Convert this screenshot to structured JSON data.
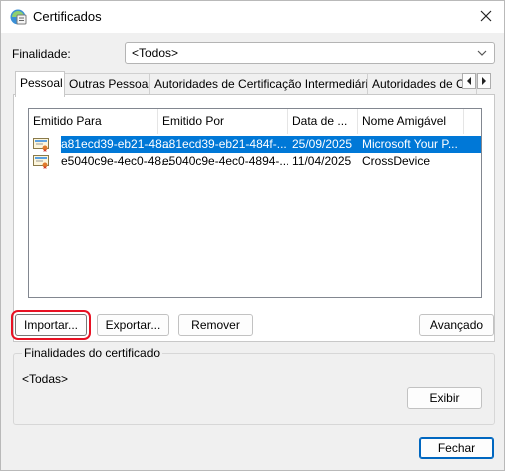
{
  "window": {
    "title": "Certificados"
  },
  "purpose": {
    "label": "Finalidade:",
    "value": "<Todos>"
  },
  "tabs": [
    {
      "label": "Pessoal",
      "active": true
    },
    {
      "label": "Outras Pessoas",
      "active": false
    },
    {
      "label": "Autoridades de Certificação Intermediárias",
      "active": false
    },
    {
      "label": "Autoridades de Ce",
      "active": false
    }
  ],
  "table": {
    "columns": [
      "Emitido Para",
      "Emitido Por",
      "Data de ...",
      "Nome Amigável"
    ],
    "rows": [
      {
        "issued_to": "a81ecd39-eb21-48...",
        "issued_by": "a81ecd39-eb21-484f-...",
        "date": "25/09/2025",
        "friendly_name": "Microsoft Your P...",
        "selected": true
      },
      {
        "issued_to": "e5040c9e-4ec0-48...",
        "issued_by": "e5040c9e-4ec0-4894-...",
        "date": "11/04/2025",
        "friendly_name": "CrossDevice",
        "selected": false
      }
    ]
  },
  "buttons": {
    "import": "Importar...",
    "export": "Exportar...",
    "remove": "Remover",
    "advanced": "Avançado",
    "view": "Exibir",
    "close": "Fechar"
  },
  "cert_purposes": {
    "title": "Finalidades do certificado",
    "value": "<Todas>"
  },
  "colors": {
    "selection": "#0078d7",
    "focus_ring": "#e81123",
    "default_button": "#0067c0"
  }
}
